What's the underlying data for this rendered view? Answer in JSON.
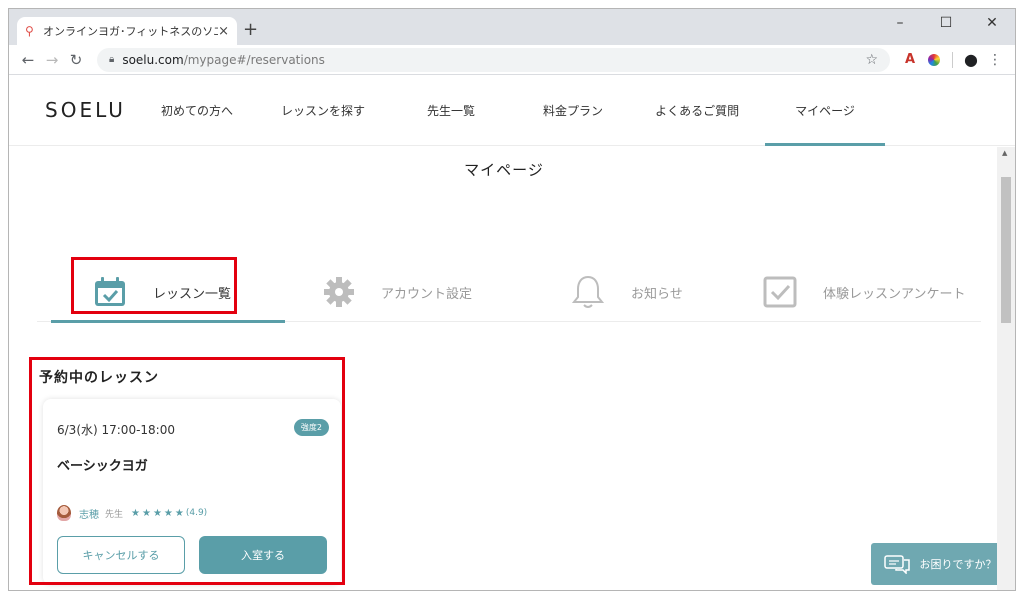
{
  "browser": {
    "tab_title": "オンラインヨガ･フィットネスのソエル",
    "tab_close": "×",
    "new_tab": "+",
    "url_host": "soelu.com",
    "url_path": "/mypage#/reservations",
    "win_min": "–",
    "win_max": "☐",
    "win_close": "✕"
  },
  "site": {
    "logo": "SOELU",
    "nav": [
      "初めての方へ",
      "レッスンを探す",
      "先生一覧",
      "料金プラン",
      "よくあるご質問",
      "マイページ"
    ],
    "active_nav": "マイページ"
  },
  "page": {
    "title": "マイページ",
    "tabs": [
      {
        "label": "レッスン一覧",
        "icon": "calendar-icon",
        "active": true
      },
      {
        "label": "アカウント設定",
        "icon": "gear-icon",
        "active": false
      },
      {
        "label": "お知らせ",
        "icon": "bell-icon",
        "active": false
      },
      {
        "label": "体験レッスンアンケート",
        "icon": "checkbox-icon",
        "active": false
      }
    ],
    "section_title": "予約中のレッスン",
    "reservation": {
      "datetime": "6/3(水) 17:00-18:00",
      "intensity_badge": "強度2",
      "lesson_name": "ベーシックヨガ",
      "teacher_name": "志穂",
      "teacher_role": "先生",
      "stars": "★★★★★",
      "rating": "(4.9)",
      "cancel_label": "キャンセルする",
      "enter_label": "入室する"
    },
    "help_label": "お困りですか？"
  },
  "colors": {
    "accent": "#5a9ea8",
    "highlight_box": "#e3000f"
  }
}
